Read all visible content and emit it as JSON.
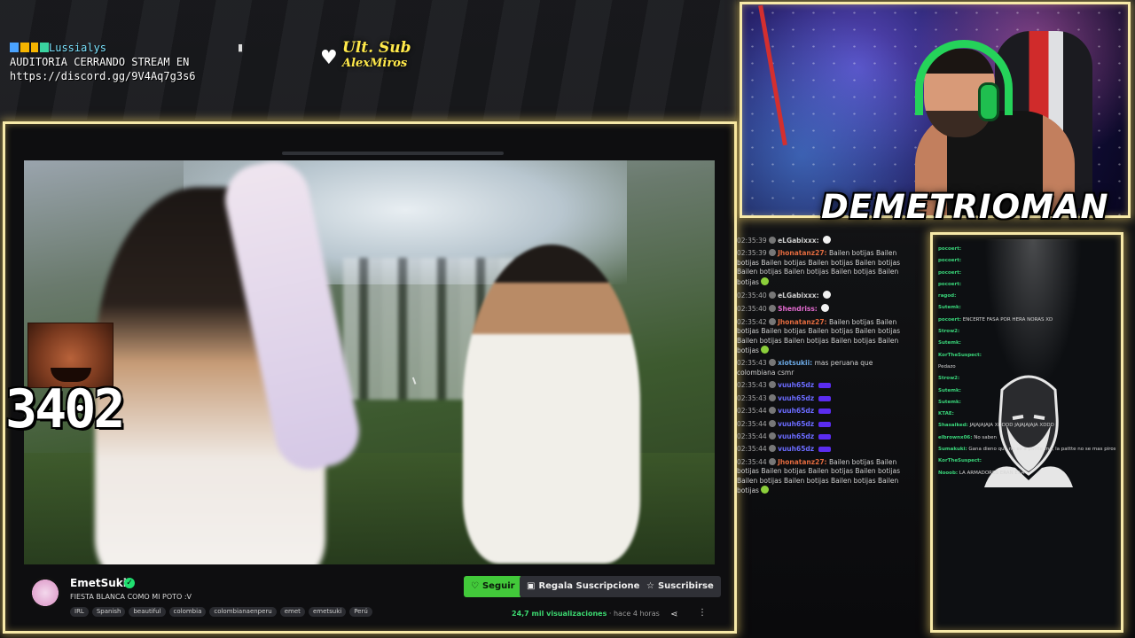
{
  "overlay": {
    "chat_marquee": {
      "username": "Lussialys",
      "line1": "AUDITORIA CERRANDO STREAM EN",
      "line2": "https://discord.gg/9V4Aq7g3s6"
    },
    "last_sub": {
      "label": "Ult. Sub",
      "name": "AlexMiros"
    },
    "streamer_name": "DEMETRIOMAN",
    "counter": "3402"
  },
  "player": {
    "channel": "EmetSuki",
    "title": "FIESTA BLANCA COMO MI POTO :V",
    "tags": [
      "IRL",
      "Spanish",
      "beautiful",
      "colombia",
      "colombianaenperu",
      "emet",
      "emetsuki",
      "Perú"
    ],
    "follow_label": "Seguir",
    "gift_label": "Regala Suscripciones",
    "subscribe_label": "Suscribirse",
    "views": "24,7 mil visualizaciones",
    "time_ago": "hace 4 horas"
  },
  "chat": {
    "messages": [
      {
        "time": "02:35:39",
        "user": "eLGabixxx:",
        "color": "#d0d0d0",
        "text": "",
        "emotes": 1
      },
      {
        "time": "02:35:39",
        "user": "Jhonatanz27:",
        "color": "#e36b3f",
        "text": "Bailen botijas Bailen botijas Bailen botijas Bailen botijas Bailen botijas Bailen botijas Bailen botijas Bailen botijas Bailen botijas"
      },
      {
        "time": "02:35:40",
        "user": "eLGabixxx:",
        "color": "#d0d0d0",
        "text": ""
      },
      {
        "time": "02:35:40",
        "user": "Shendriss:",
        "color": "#e36bd0",
        "text": ""
      },
      {
        "time": "02:35:42",
        "user": "Jhonatanz27:",
        "color": "#e36b3f",
        "text": "Bailen botijas Bailen botijas Bailen botijas Bailen botijas Bailen botijas Bailen botijas Bailen botijas Bailen botijas Bailen botijas"
      },
      {
        "time": "02:35:43",
        "user": "xiotsukii:",
        "color": "#6ba8e3",
        "text": "mas peruana que colombiana csmr"
      },
      {
        "time": "02:35:43",
        "user": "vuuh65dz",
        "color": "#6b6bff",
        "text": ""
      },
      {
        "time": "02:35:43",
        "user": "vuuh65dz",
        "color": "#6b6bff",
        "text": ""
      },
      {
        "time": "02:35:44",
        "user": "vuuh65dz",
        "color": "#6b6bff",
        "text": ""
      },
      {
        "time": "02:35:44",
        "user": "vuuh65dz",
        "color": "#6b6bff",
        "text": ""
      },
      {
        "time": "02:35:44",
        "user": "vuuh65dz",
        "color": "#6b6bff",
        "text": ""
      },
      {
        "time": "02:35:44",
        "user": "vuuh65dz",
        "color": "#6b6bff",
        "text": ""
      },
      {
        "time": "02:35:44",
        "user": "Jhonatanz27:",
        "color": "#e36b3f",
        "text": "Bailen botijas Bailen botijas Bailen botijas Bailen botijas Bailen botijas Bailen botijas Bailen botijas Bailen botijas Bailen botijas"
      }
    ]
  },
  "side_chat": {
    "lines": [
      {
        "user": "pocoert:",
        "text": ""
      },
      {
        "user": "pocoert:",
        "text": ""
      },
      {
        "user": "pocoert:",
        "text": ""
      },
      {
        "user": "pocoert:",
        "text": ""
      },
      {
        "user": "ragod:",
        "text": ""
      },
      {
        "user": "Sutemk:",
        "text": ""
      },
      {
        "user": "pocoert:",
        "text": "ENCERTE FASA POR HERA NORAS XD"
      },
      {
        "user": "Strow2:",
        "text": ""
      },
      {
        "user": "Sutemk:",
        "text": ""
      },
      {
        "user": "KorTheSuspect:",
        "text": ""
      },
      {
        "user": "",
        "text": "Pedazo"
      },
      {
        "user": "Strow2:",
        "text": ""
      },
      {
        "user": "Sutemk:",
        "text": ""
      },
      {
        "user": "Sutemk:",
        "text": ""
      },
      {
        "user": "KTAE:",
        "text": ""
      },
      {
        "user": "Shasaiked:",
        "text": "JAJAJAJAJA XDDDD JAJAJAJAJA XDDD"
      },
      {
        "user": "elbrownx06:",
        "text": "No saben"
      },
      {
        "user": "Sumakuki:",
        "text": "Gana dieno que no es a pattte me, la pattte no se mas piros"
      },
      {
        "user": "KorTheSuspect:",
        "text": ""
      },
      {
        "user": "Nooob:",
        "text": "LA ARMADORES ERAN ESA"
      }
    ]
  },
  "colors": {
    "frame": "#f7e9a8",
    "follow": "#42c93a",
    "streamer_text": "#ffffff",
    "last_sub": "#ffe94a"
  }
}
